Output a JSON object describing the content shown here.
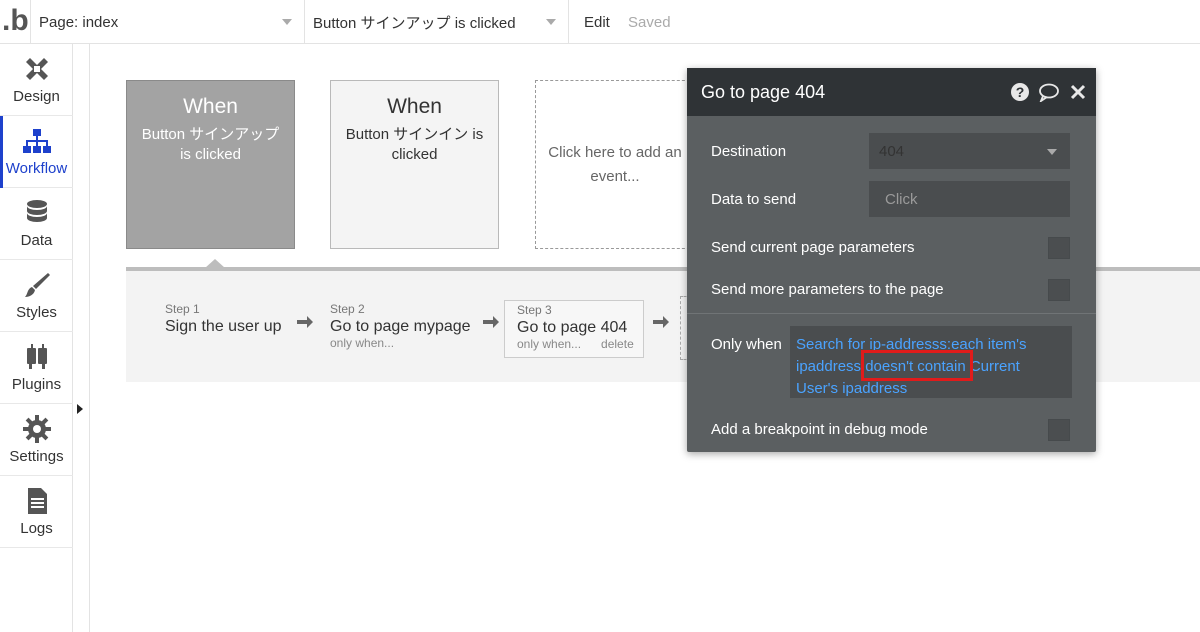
{
  "topbar": {
    "logo": ".b",
    "page_select": "Page: index",
    "event_select": "Button サインアップ is clicked",
    "edit_label": "Edit",
    "saved_label": "Saved"
  },
  "sidebar": {
    "items": [
      {
        "label": "Design",
        "icon": "design-icon"
      },
      {
        "label": "Workflow",
        "icon": "workflow-icon"
      },
      {
        "label": "Data",
        "icon": "database-icon"
      },
      {
        "label": "Styles",
        "icon": "brush-icon"
      },
      {
        "label": "Plugins",
        "icon": "plug-icon"
      },
      {
        "label": "Settings",
        "icon": "gear-icon"
      },
      {
        "label": "Logs",
        "icon": "document-icon"
      }
    ],
    "active": "Workflow"
  },
  "events": [
    {
      "when": "When",
      "desc": "Button サインアップ is clicked"
    },
    {
      "when": "When",
      "desc": "Button サインイン is clicked"
    }
  ],
  "add_event": {
    "line1": "Click here to add an",
    "line2": "event..."
  },
  "steps": [
    {
      "num": "Step 1",
      "name": "Sign the user up",
      "sub": ""
    },
    {
      "num": "Step 2",
      "name": "Go to page mypage",
      "sub": "only when..."
    },
    {
      "num": "Step 3",
      "name": "Go to page 404",
      "sub": "only when...",
      "delete": "delete"
    }
  ],
  "popup": {
    "title": "Go to page 404",
    "destination_label": "Destination",
    "destination_value": "404",
    "data_to_send_label": "Data to send",
    "data_to_send_placeholder": "Click",
    "send_current_label": "Send current page parameters",
    "send_more_label": "Send more parameters to the page",
    "only_when_label": "Only when",
    "condition": {
      "part1": "Search for ip-addresss:each item's ipaddress ",
      "highlight": "doesn't contain",
      "part2": " Current User's ipaddress"
    },
    "breakpoint_label": "Add a breakpoint in debug mode"
  },
  "colors": {
    "accent": "#1e41cc",
    "popup_bg": "#5b5f61",
    "popup_header": "#2f3336",
    "link": "#4aa3ff",
    "highlight_border": "#e01b1b"
  }
}
